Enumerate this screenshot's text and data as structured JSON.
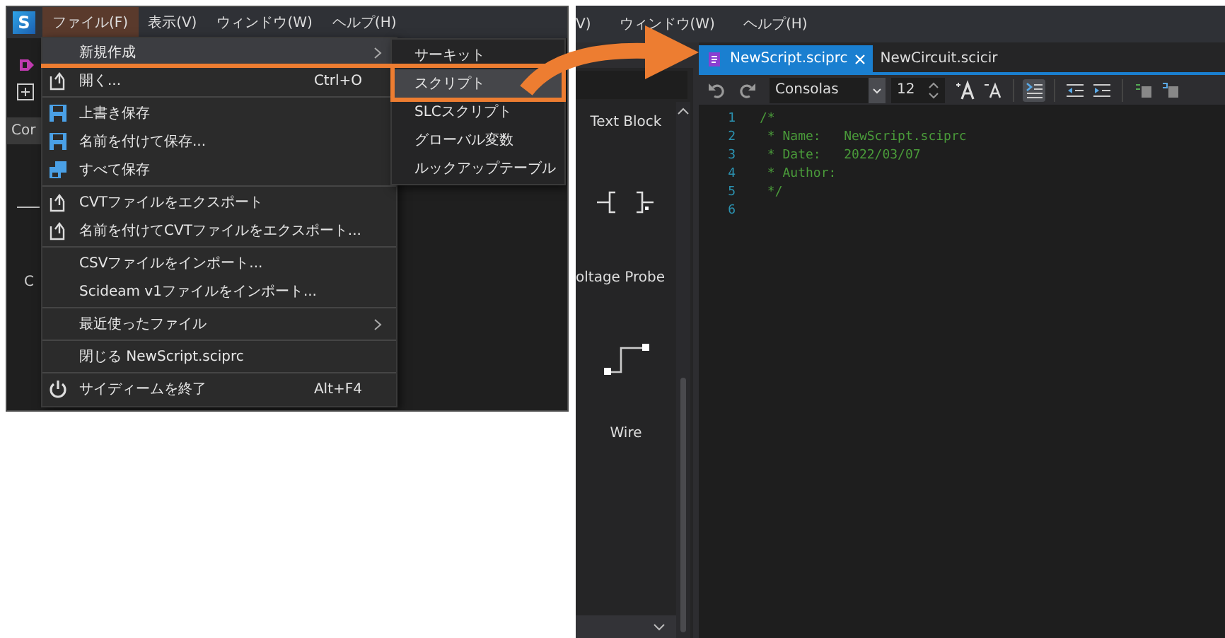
{
  "left_screenshot": {
    "app_logo": "S",
    "menu_bar": [
      {
        "label": "ファイル(F)",
        "selected": true
      },
      {
        "label": "表示(V)",
        "selected": false
      },
      {
        "label": "ウィンドウ(W)",
        "selected": false
      },
      {
        "label": "ヘルプ(H)",
        "selected": false
      }
    ],
    "side_tab": "Cor",
    "side_label": "C",
    "file_menu": [
      [
        {
          "label": "新規作成",
          "selected": true,
          "has_submenu": true
        },
        {
          "label": "開く...",
          "shortcut": "Ctrl+O",
          "selected": false,
          "has_submenu": false
        }
      ],
      [
        {
          "label": "上書き保存",
          "selected": false,
          "has_submenu": false
        },
        {
          "label": "名前を付けて保存...",
          "selected": false,
          "has_submenu": false
        },
        {
          "label": "すべて保存",
          "selected": false,
          "has_submenu": false
        }
      ],
      [
        {
          "label": "CVTファイルをエクスポート",
          "selected": false,
          "has_submenu": false
        },
        {
          "label": "名前を付けてCVTファイルをエクスポート...",
          "selected": false,
          "has_submenu": false
        }
      ],
      [
        {
          "label": "CSVファイルをインポート...",
          "selected": false,
          "has_submenu": false
        },
        {
          "label": "Scideam v1ファイルをインポート...",
          "selected": false,
          "has_submenu": false
        }
      ],
      [
        {
          "label": "最近使ったファイル",
          "selected": false,
          "has_submenu": true
        }
      ],
      [
        {
          "label": "閉じる NewScript.sciprc",
          "selected": false,
          "has_submenu": false
        }
      ],
      [
        {
          "label": "サイディームを終了",
          "shortcut": "Alt+F4",
          "selected": false,
          "has_submenu": false
        }
      ]
    ],
    "new_submenu": [
      {
        "label": "サーキット",
        "selected": false
      },
      {
        "label": "スクリプト",
        "selected": true
      },
      {
        "label": "SLCスクリプト",
        "selected": false
      },
      {
        "label": "グローバル変数",
        "selected": false
      },
      {
        "label": "ルックアップテーブル",
        "selected": false
      }
    ]
  },
  "right_screenshot": {
    "menu_bar": [
      "V)",
      "ウィンドウ(W)",
      "ヘルプ(H)"
    ],
    "palette": [
      {
        "label": "Text Block"
      },
      {
        "label": "oltage Probe"
      },
      {
        "label": "Wire"
      }
    ],
    "tabs": [
      {
        "label": "NewScript.sciprc",
        "selected": true
      },
      {
        "label": "NewCircuit.scicir",
        "selected": false
      }
    ],
    "toolbar": {
      "font": "Consolas",
      "font_size": "12",
      "buttons": [
        {
          "pressed": false
        },
        {
          "pressed": false
        },
        {
          "pressed": false
        },
        {
          "pressed": false
        },
        {
          "pressed": true
        },
        {
          "pressed": false
        },
        {
          "pressed": false
        },
        {
          "pressed": false
        },
        {
          "pressed": false
        }
      ]
    },
    "code_lines": [
      {
        "number": "1",
        "text": "/*"
      },
      {
        "number": "2",
        "text": " * Name:   NewScript.sciprc"
      },
      {
        "number": "3",
        "text": " * Date:   2022/03/07"
      },
      {
        "number": "4",
        "text": " * Author:"
      },
      {
        "number": "5",
        "text": " */"
      },
      {
        "number": "6"
      }
    ]
  }
}
